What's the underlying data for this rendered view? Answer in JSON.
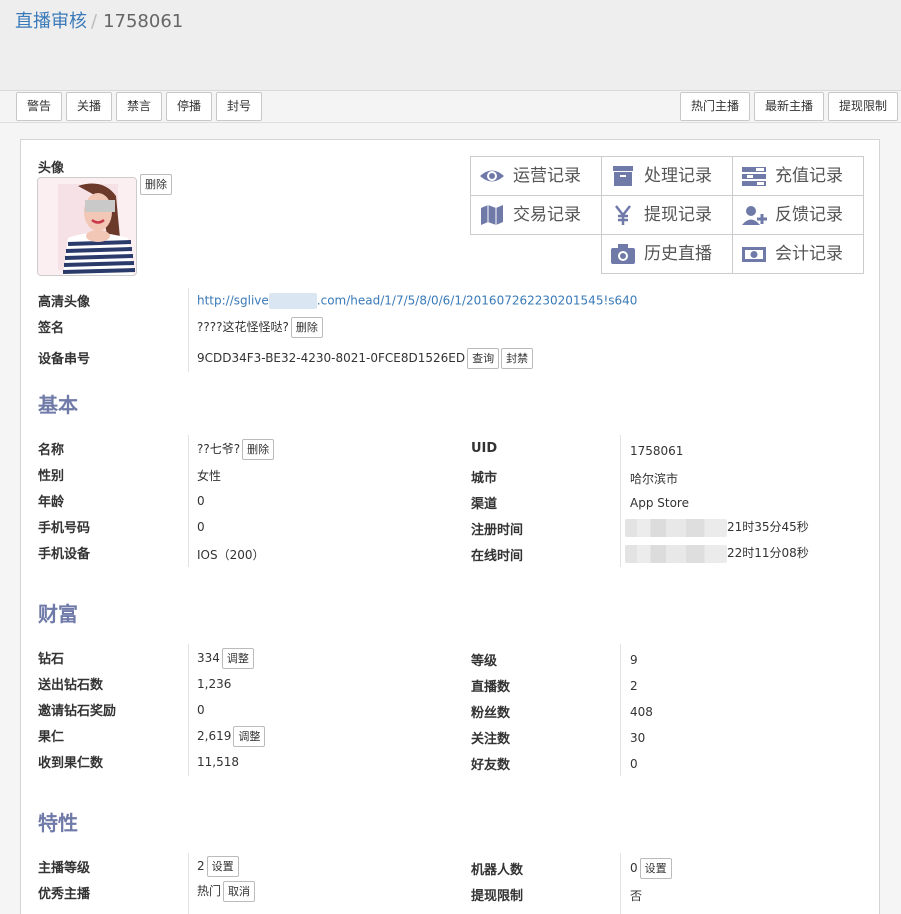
{
  "breadcrumb": {
    "parent": "直播审核",
    "separator": "/",
    "current": "1758061"
  },
  "toolbar": {
    "left": [
      "警告",
      "关播",
      "禁言",
      "停播",
      "封号"
    ],
    "right": [
      "热门主播",
      "最新主播",
      "提现限制"
    ]
  },
  "avatar": {
    "label": "头像",
    "delete": "删除"
  },
  "links": [
    {
      "label": "运营记录",
      "icon": "eye-icon"
    },
    {
      "label": "处理记录",
      "icon": "archive-icon"
    },
    {
      "label": "充值记录",
      "icon": "tasks-icon"
    },
    {
      "label": "交易记录",
      "icon": "map-icon"
    },
    {
      "label": "提现记录",
      "icon": "yen-icon"
    },
    {
      "label": "反馈记录",
      "icon": "user-plus-icon"
    },
    {
      "label": "历史直播",
      "icon": "camera-icon"
    },
    {
      "label": "会计记录",
      "icon": "money-icon"
    }
  ],
  "profile": {
    "hd_avatar_label": "高清头像",
    "hd_avatar_url_prefix": "http://sglive",
    "hd_avatar_url_suffix": ".com/head/1/7/5/8/0/6/1/20160726223020154​5!s640",
    "signature_label": "签名",
    "signature_value": "????这花怪怪哒?",
    "signature_delete": "删除",
    "device_label": "设备串号",
    "device_value": "9CDD34F3-BE32-4230-8021-0FCE8D1526ED",
    "device_query": "查询",
    "device_ban": "封禁"
  },
  "basic": {
    "title": "基本",
    "name_label": "名称",
    "name_value": "??七爷?",
    "name_delete": "删除",
    "gender_label": "性别",
    "gender_value": "女性",
    "age_label": "年龄",
    "age_value": "0",
    "phone_label": "手机号码",
    "phone_value": "0",
    "device_label": "手机设备",
    "device_value": "IOS（200）",
    "uid_label": "UID",
    "uid_value": "1758061",
    "city_label": "城市",
    "city_value": "哈尔滨市",
    "channel_label": "渠道",
    "channel_value": "App Store",
    "reg_label": "注册时间",
    "reg_value": "21时35分45秒",
    "online_label": "在线时间",
    "online_value": "22时11分08秒"
  },
  "wealth": {
    "title": "财富",
    "diamond_label": "钻石",
    "diamond_value": "334",
    "diamond_adjust": "调整",
    "sent_label": "送出钻石数",
    "sent_value": "1,236",
    "invite_label": "邀请钻石奖励",
    "invite_value": "0",
    "nut_label": "果仁",
    "nut_value": "2,619",
    "nut_adjust": "调整",
    "recv_label": "收到果仁数",
    "recv_value": "11,518",
    "level_label": "等级",
    "level_value": "9",
    "live_label": "直播数",
    "live_value": "2",
    "fans_label": "粉丝数",
    "fans_value": "408",
    "follow_label": "关注数",
    "follow_value": "30",
    "friends_label": "好友数",
    "friends_value": "0"
  },
  "traits": {
    "title": "特性",
    "anchor_level_label": "主播等级",
    "anchor_level_value": "2",
    "anchor_level_set": "设置",
    "excellent_label": "优秀主播",
    "excellent_value": "热门",
    "excellent_cancel": "取消",
    "robots_label": "机器人数",
    "robots_value": "0",
    "robots_set": "设置",
    "withdraw_label": "提现限制",
    "withdraw_value": "否"
  },
  "colors": {
    "link": "#3a7ab8",
    "section": "#6f7aa8",
    "icon": "#6f7aa8"
  }
}
